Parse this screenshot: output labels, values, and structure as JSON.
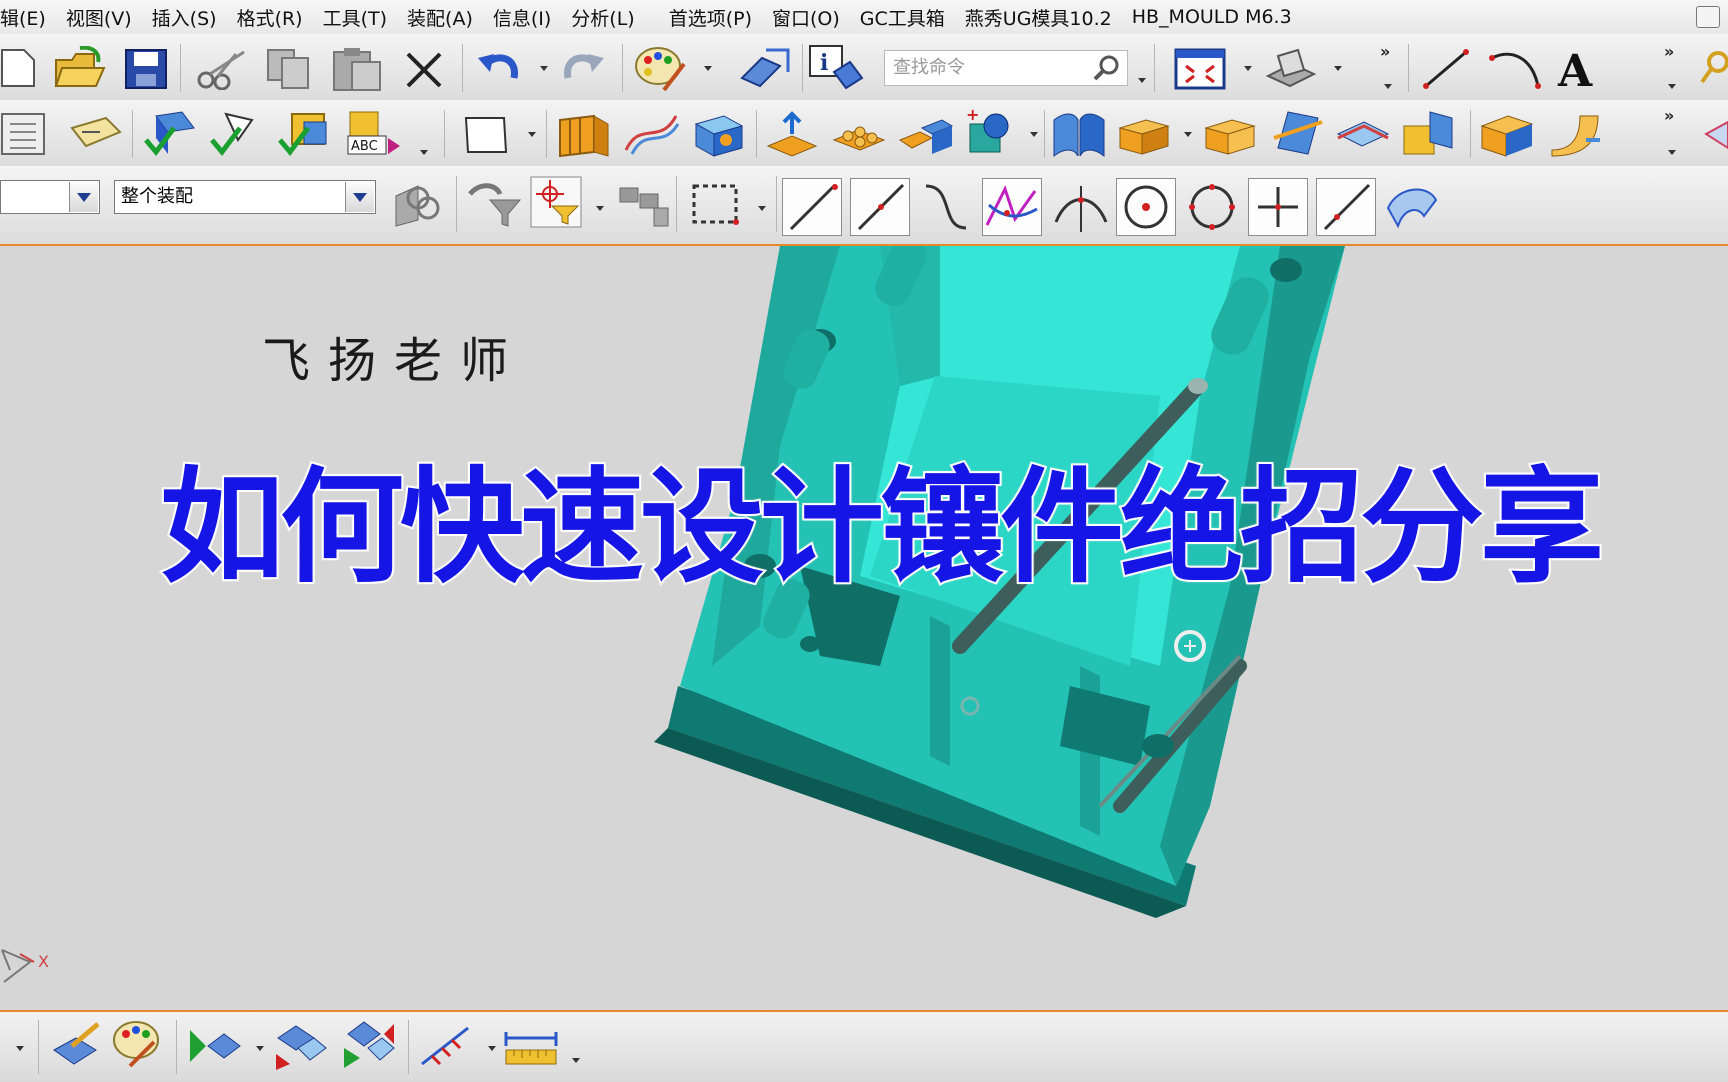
{
  "menu": {
    "items": [
      "辑(E)",
      "视图(V)",
      "插入(S)",
      "格式(R)",
      "工具(T)",
      "装配(A)",
      "信息(I)",
      "分析(L)",
      "首选项(P)",
      "窗口(O)",
      "GC工具箱",
      "燕秀UG模具10.2",
      "HB_MOULD M6.3"
    ]
  },
  "toolbar1": {
    "search_placeholder": "查找命令",
    "overflow_1": "»",
    "overflow_2": "»"
  },
  "toolbar2": {
    "overflow": "»"
  },
  "toolbar3": {
    "filter_value": "",
    "scope_value": "整个装配"
  },
  "viewport": {
    "teacher_name": "飞扬老师",
    "headline": "如何快速设计镶件绝招分享",
    "axis_label": "X"
  },
  "colors": {
    "headline": "#1515e6",
    "model_face": "#2fd8c8",
    "model_dark": "#14a89a",
    "selection_line": "#e48a2a"
  },
  "icons": [
    "new-file-icon",
    "open-folder-icon",
    "save-icon",
    "cut-icon",
    "copy-icon",
    "paste-icon",
    "delete-icon",
    "undo-icon",
    "redo-icon",
    "palette-icon",
    "orient-icon",
    "info-icon",
    "search-icon",
    "fit-view-icon",
    "shaded-view-icon",
    "line-icon",
    "arc-icon",
    "text-icon"
  ]
}
